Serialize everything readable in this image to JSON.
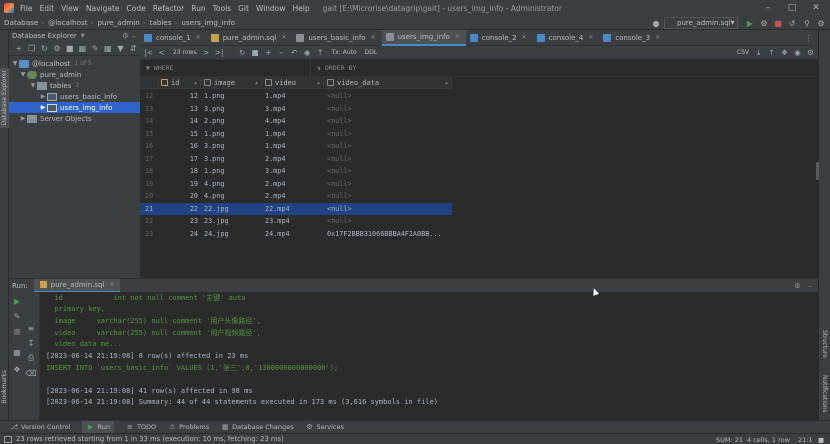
{
  "titlebar": {
    "menu": [
      "File",
      "Edit",
      "View",
      "Navigate",
      "Code",
      "Refactor",
      "Run",
      "Tools",
      "Git",
      "Window",
      "Help"
    ],
    "title": "gait [E:\\Microrise\\datagrip\\gait] - users_img_info - Administrator",
    "window_controls": [
      "minimize",
      "maximize",
      "close"
    ]
  },
  "navbar": {
    "crumbs": [
      "Database",
      "@localhost",
      "pure_admin",
      "tables",
      "users_img_info"
    ],
    "run_config": "pure_admin.sql"
  },
  "db_explorer": {
    "header": "Database Explorer",
    "left_tab": "Database Explorer",
    "tree": [
      {
        "label": "@localhost",
        "badge": "1 of 5",
        "level": 0,
        "expanded": true,
        "icon": "server"
      },
      {
        "label": "pure_admin",
        "badge": "",
        "level": 1,
        "expanded": true,
        "icon": "schema"
      },
      {
        "label": "tables",
        "badge": "2",
        "level": 2,
        "expanded": true,
        "icon": "folder"
      },
      {
        "label": "users_basic_info",
        "badge": "",
        "level": 3,
        "expanded": false,
        "icon": "table"
      },
      {
        "label": "users_img_info",
        "badge": "",
        "level": 3,
        "expanded": false,
        "icon": "table",
        "selected": true
      },
      {
        "label": "Server Objects",
        "badge": "",
        "level": 1,
        "expanded": false,
        "icon": "folder"
      }
    ]
  },
  "tabs": [
    {
      "label": "console_1",
      "icon_color": "#4a88c7",
      "active": false
    },
    {
      "label": "pure_admin.sql",
      "icon_color": "#c9a14a",
      "active": false
    },
    {
      "label": "users_basic_info",
      "icon_color": "#8a8f94",
      "active": false
    },
    {
      "label": "users_img_info",
      "icon_color": "#8a8f94",
      "active": true
    },
    {
      "label": "console_2",
      "icon_color": "#4a88c7",
      "active": false
    },
    {
      "label": "console_4",
      "icon_color": "#4a88c7",
      "active": false
    },
    {
      "label": "console_3",
      "icon_color": "#4a88c7",
      "active": false
    }
  ],
  "grid_toolbar": {
    "rows_label": "23 rows",
    "tx_label": "Tx: Auto",
    "ddl_label": "DDL",
    "export_label": "CSV"
  },
  "filter": {
    "where": "WHERE",
    "order_by": "ORDER BY"
  },
  "grid": {
    "columns": [
      "id",
      "image",
      "video",
      "video_data"
    ],
    "rows": [
      {
        "n": "12",
        "id": "12",
        "image": "1.png",
        "video": "1.mp4",
        "video_data": "<null>"
      },
      {
        "n": "13",
        "id": "13",
        "image": "3.png",
        "video": "3.mp4",
        "video_data": "<null>"
      },
      {
        "n": "14",
        "id": "14",
        "image": "2.png",
        "video": "4.mp4",
        "video_data": "<null>"
      },
      {
        "n": "15",
        "id": "15",
        "image": "1.png",
        "video": "1.mp4",
        "video_data": "<null>"
      },
      {
        "n": "16",
        "id": "16",
        "image": "3.png",
        "video": "1.mp4",
        "video_data": "<null>"
      },
      {
        "n": "17",
        "id": "17",
        "image": "3.png",
        "video": "2.mp4",
        "video_data": "<null>"
      },
      {
        "n": "18",
        "id": "18",
        "image": "1.png",
        "video": "3.mp4",
        "video_data": "<null>"
      },
      {
        "n": "19",
        "id": "19",
        "image": "4.png",
        "video": "2.mp4",
        "video_data": "<null>"
      },
      {
        "n": "20",
        "id": "20",
        "image": "4.png",
        "video": "2.mp4",
        "video_data": "<null>"
      },
      {
        "n": "21",
        "id": "22",
        "image": "22.jpg",
        "video": "22.mp4",
        "video_data": "<null>",
        "selected": true
      },
      {
        "n": "22",
        "id": "23",
        "image": "23.jpg",
        "video": "23.mp4",
        "video_data": "<null>"
      },
      {
        "n": "23",
        "id": "24",
        "image": "24.jpg",
        "video": "24.mp4",
        "video_data": "0x17F2BBB31066BBBA4F2A0BB..."
      }
    ]
  },
  "run_panel": {
    "label": "Run:",
    "tab": "pure_admin.sql",
    "console": [
      {
        "text": "  id            int not null comment '主键' auto",
        "color": "green"
      },
      {
        "text": "  primary key,",
        "color": "green"
      },
      {
        "text": "  image     varchar(255) null comment '用户头像路径',",
        "color": "green"
      },
      {
        "text": "  video     varchar(255) null comment '用户视频路径',",
        "color": "green"
      },
      {
        "text": "  video_data me...",
        "color": "green"
      },
      {
        "text": "[2023-06-14 21:19:08] 8 row(s) affected in 23 ms",
        "color": "gray"
      },
      {
        "text": "INSERT INTO `users_basic_info` VALUES (1,'张三',0,'1300000000000000');",
        "color": "green"
      },
      {
        "text": "",
        "color": "gray"
      },
      {
        "text": "[2023-06-14 21:19:08] 41 row(s) affected in 98 ms",
        "color": "gray"
      },
      {
        "text": "[2023-06-14 21:19:08] Summary: 44 of 44 statements executed in 173 ms (3,616 symbols in file)",
        "color": "gray"
      }
    ]
  },
  "right_strip": [
    "Structure",
    "Notifications"
  ],
  "left_strip_bottom": "Bookmarks",
  "bottom_tools": [
    {
      "label": "Version Control",
      "icon": "branch-icon",
      "active": false
    },
    {
      "label": "Run",
      "icon": "play-icon",
      "active": true
    },
    {
      "label": "TODO",
      "icon": "list-icon",
      "active": false
    },
    {
      "label": "Problems",
      "icon": "warning-icon",
      "active": false
    },
    {
      "label": "Database Changes",
      "icon": "database-icon",
      "active": false
    },
    {
      "label": "Services",
      "icon": "services-icon",
      "active": false
    }
  ],
  "status": {
    "message": "23 rows retrieved starting from 1 in 33 ms (execution: 10 ms, fetching: 23 ms)",
    "sum": "SUM: 21",
    "cells": "4 cells, 1 row",
    "position": "21:1"
  },
  "colors": {
    "accent": "#4a88c7",
    "selection": "#214283",
    "console_green": "#4e9a3c",
    "run_green": "#499c54"
  }
}
